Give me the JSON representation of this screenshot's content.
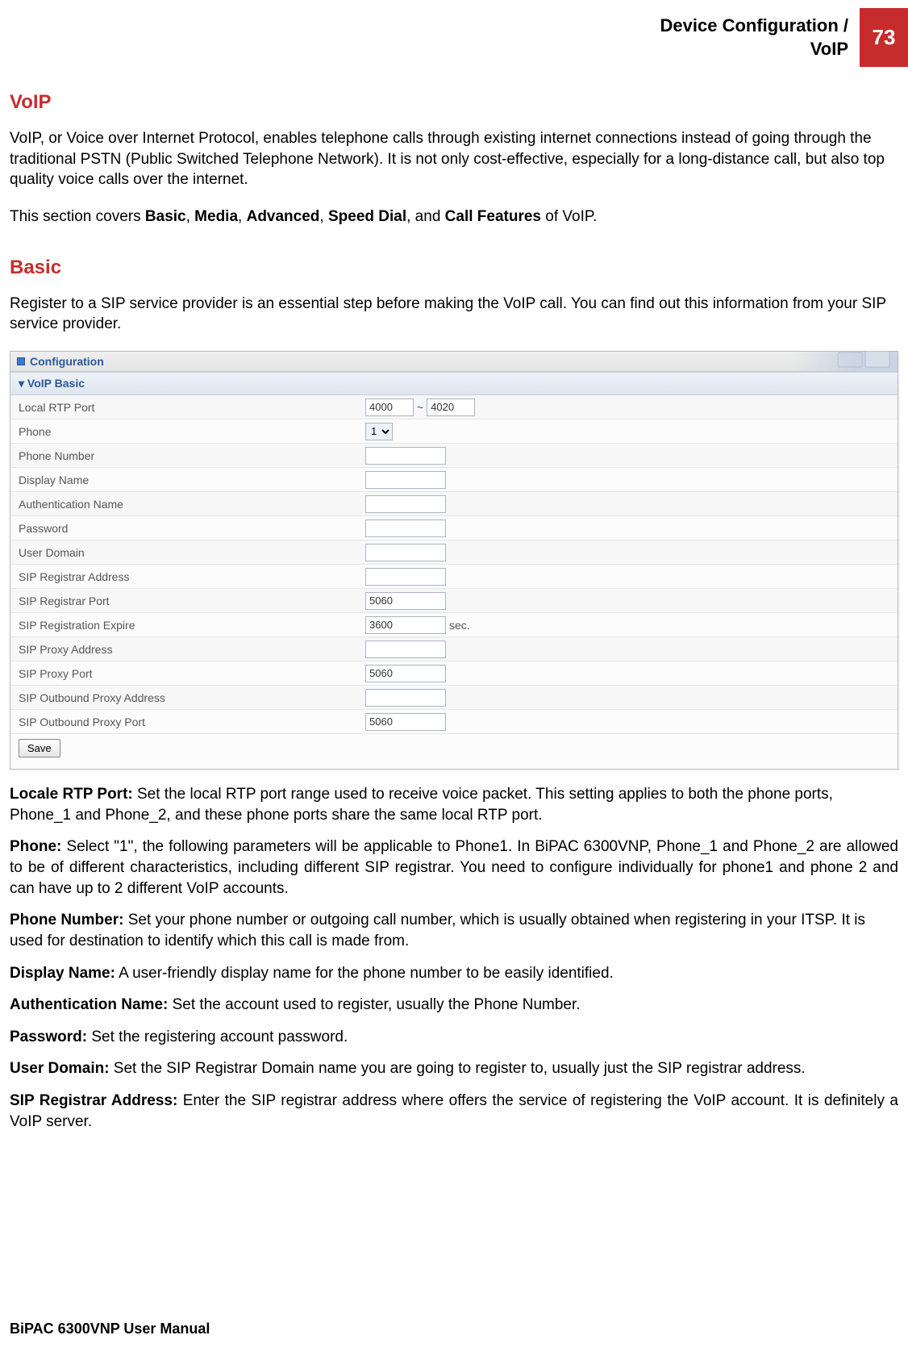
{
  "header": {
    "title_line1": "Device Configuration /",
    "title_line2": "VoIP",
    "page_number": "73"
  },
  "section1": {
    "heading": "VoIP",
    "p1": "VoIP, or Voice over Internet Protocol, enables telephone calls through existing internet connections instead of going through the traditional PSTN (Public Switched Telephone Network). It is not only cost-effective, especially for a long-distance call, but also top quality voice calls over the internet.",
    "p2_pre": "This section covers ",
    "p2_items": [
      "Basic",
      "Media",
      "Advanced",
      "Speed Dial",
      "Call Features"
    ],
    "p2_post": " of VoIP."
  },
  "section2": {
    "heading": "Basic",
    "intro": "Register to a SIP service provider is an essential step before making the VoIP call. You can find out this information from your SIP service provider."
  },
  "screenshot": {
    "top_title": "Configuration",
    "section_title": "VoIP Basic",
    "rows": [
      {
        "label": "Local RTP Port",
        "type": "range",
        "v1": "4000",
        "sep": "~",
        "v2": "4020"
      },
      {
        "label": "Phone",
        "type": "select",
        "value": "1"
      },
      {
        "label": "Phone Number",
        "type": "text",
        "value": ""
      },
      {
        "label": "Display Name",
        "type": "text",
        "value": ""
      },
      {
        "label": "Authentication Name",
        "type": "text",
        "value": ""
      },
      {
        "label": "Password",
        "type": "text",
        "value": ""
      },
      {
        "label": "User Domain",
        "type": "text",
        "value": ""
      },
      {
        "label": "SIP Registrar Address",
        "type": "text",
        "value": ""
      },
      {
        "label": "SIP Registrar Port",
        "type": "text",
        "value": "5060"
      },
      {
        "label": "SIP Registration Expire",
        "type": "text_suffix",
        "value": "3600",
        "suffix": "sec."
      },
      {
        "label": "SIP Proxy Address",
        "type": "text",
        "value": ""
      },
      {
        "label": "SIP Proxy Port",
        "type": "text",
        "value": "5060"
      },
      {
        "label": "SIP Outbound Proxy Address",
        "type": "text",
        "value": ""
      },
      {
        "label": "SIP Outbound Proxy Port",
        "type": "text",
        "value": "5060"
      }
    ],
    "save_label": "Save"
  },
  "definitions": [
    {
      "term": "Locale RTP Port:",
      "text": " Set the local RTP port range used to receive voice packet. This setting applies to both the phone ports, Phone_1 and Phone_2, and these phone ports share the same local RTP port."
    },
    {
      "term": "Phone:",
      "text": " Select \"1\", the following parameters will be applicable to Phone1. In BiPAC 6300VNP, Phone_1 and Phone_2 are allowed to be of different characteristics, including different SIP registrar. You need to configure individually for phone1 and phone 2 and can have up to 2 different VoIP accounts.",
      "justify": true
    },
    {
      "term": "Phone Number:",
      "text": " Set your phone number or outgoing call number, which is usually obtained when registering in your ITSP. It is used for destination to identify which this call is made from."
    },
    {
      "term": "Display Name:",
      "text": " A user-friendly display name for the phone number to be easily identified."
    },
    {
      "term": "Authentication Name:",
      "text": " Set the account used to register, usually the Phone Number."
    },
    {
      "term": "Password:",
      "text": " Set the registering account password."
    },
    {
      "term": "User Domain:",
      "text": " Set the SIP Registrar Domain name you are going to register to, usually just the SIP registrar address."
    },
    {
      "term": "SIP Registrar Address:",
      "text": " Enter the SIP registrar address where offers the service of registering the VoIP account. It is definitely a VoIP server.",
      "justify": true
    }
  ],
  "footer": "BiPAC 6300VNP User Manual"
}
